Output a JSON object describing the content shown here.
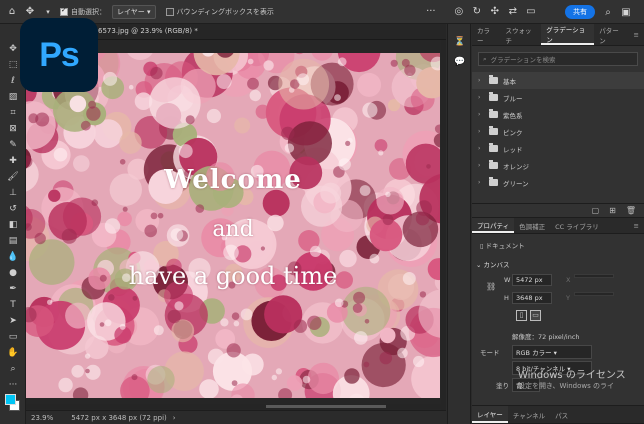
{
  "options_bar": {
    "auto_select_label": "自動選択：",
    "layer_select": "レイヤー",
    "bounding_box_label": "バウンディングボックスを表示",
    "share_label": "共有"
  },
  "app": {
    "logo_text": "Ps"
  },
  "document": {
    "tab_title": "6573.jpg @ 23.9% (RGB/8) *",
    "headline1": "Welcome",
    "headline2": "and",
    "headline3": "have a good time"
  },
  "status_bar": {
    "zoom": "23.9%",
    "info": "5472 px x 3648 px (72 ppi)"
  },
  "panel_top": {
    "tabs": [
      "カラー",
      "スウォッチ",
      "グラデーション",
      "パターン"
    ],
    "active_tab": "グラデーション",
    "search_placeholder": "グラデーションを検索",
    "folders": [
      "基本",
      "ブルー",
      "紫色系",
      "ピンク",
      "レッド",
      "オレンジ",
      "グリーン"
    ]
  },
  "panel_props": {
    "tabs": [
      "プロパティ",
      "色調補正",
      "CC ライブラリ"
    ],
    "active_tab": "プロパティ",
    "doc_label": "ドキュメント",
    "section_canvas": "カンバス",
    "w_label": "W",
    "w_value": "5472 px",
    "x_label": "X",
    "h_label": "H",
    "h_value": "3648 px",
    "y_label": "Y",
    "resolution": "解像度：72 pixel/inch",
    "mode_label": "モード",
    "mode_value": "RGB カラー",
    "bits_value": "8 bit/チャンネル",
    "fill_label": "塗り",
    "fill_partial": "背"
  },
  "panel_layers": {
    "tabs": [
      "レイヤー",
      "チャンネル",
      "パス"
    ],
    "active_tab": "レイヤー"
  },
  "watermark": {
    "line1": "Windows のライセンス",
    "line2": "設定を開き、Windows のライ"
  },
  "colors": {
    "accent": "#1473e6",
    "ps_blue": "#31a8ff",
    "ps_dark": "#001e36"
  }
}
